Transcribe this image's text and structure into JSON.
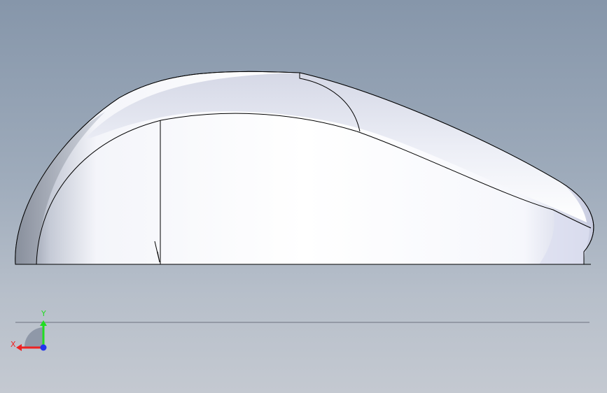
{
  "viewport": {
    "background_top": "#8696aa",
    "background_bottom": "#c4c9d1"
  },
  "model": {
    "name_icon": "mouse-shell-side-view",
    "body_color": "#ffffff",
    "shade_color": "#8f98a8",
    "edge_color": "#000000"
  },
  "triad": {
    "y_label": "Y",
    "x_label": "X",
    "y_color": "#22dd22",
    "x_color": "#ee2222",
    "z_color": "#2233ee"
  }
}
